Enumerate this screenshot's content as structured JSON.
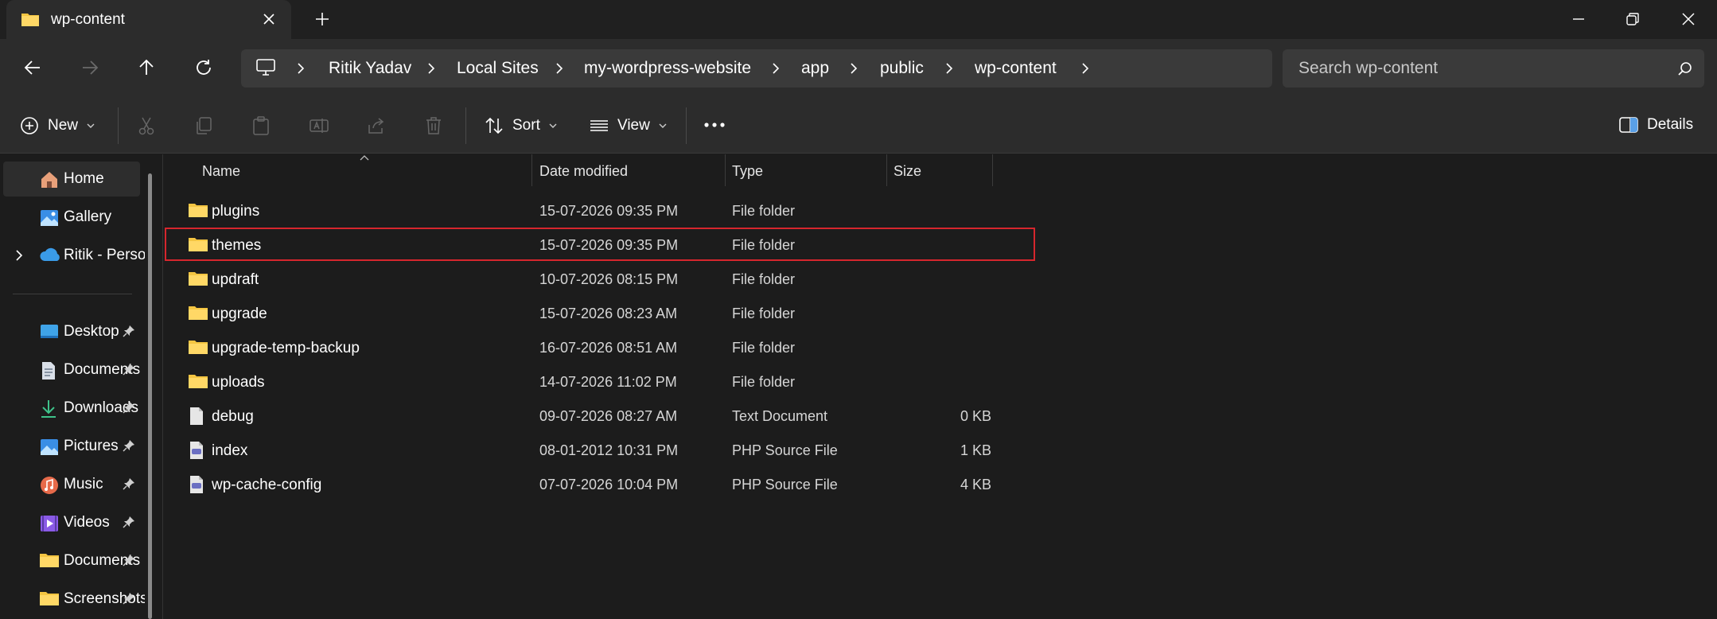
{
  "window": {
    "tab_title": "wp-content",
    "tab_icon": "folder-icon",
    "colors": {
      "background": "#1c1c1c",
      "chrome": "#2c2c2c",
      "folder": "#f4c542",
      "highlight": "#d6262d"
    }
  },
  "nav": {
    "back": "back-arrow-icon",
    "forward": "forward-arrow-icon",
    "up": "up-arrow-icon",
    "refresh": "refresh-icon"
  },
  "breadcrumb": [
    "Ritik Yadav",
    "Local Sites",
    "my-wordpress-website",
    "app",
    "public",
    "wp-content"
  ],
  "search": {
    "placeholder": "Search wp-content"
  },
  "toolbar": {
    "new_label": "New",
    "sort_label": "Sort",
    "view_label": "View",
    "details_label": "Details"
  },
  "sidebar": {
    "items": [
      {
        "label": "Home",
        "icon": "home-icon"
      },
      {
        "label": "Gallery",
        "icon": "gallery-icon"
      },
      {
        "label": "Ritik - Personal",
        "icon": "onedrive-cloud-icon"
      },
      {
        "label": "Desktop",
        "icon": "desktop-icon"
      },
      {
        "label": "Documents",
        "icon": "documents-icon"
      },
      {
        "label": "Downloads",
        "icon": "download-icon"
      },
      {
        "label": "Pictures",
        "icon": "pictures-icon"
      },
      {
        "label": "Music",
        "icon": "music-icon"
      },
      {
        "label": "Videos",
        "icon": "videos-icon"
      },
      {
        "label": "Documents",
        "icon": "folder-icon"
      },
      {
        "label": "Screenshots",
        "icon": "folder-icon"
      }
    ]
  },
  "columns": {
    "name": "Name",
    "date": "Date modified",
    "type": "Type",
    "size": "Size"
  },
  "files": [
    {
      "name": "plugins",
      "date": "15-07-2026 09:35 PM",
      "type": "File folder",
      "size": "",
      "icon": "folder-icon"
    },
    {
      "name": "themes",
      "date": "15-07-2026 09:35 PM",
      "type": "File folder",
      "size": "",
      "icon": "folder-icon"
    },
    {
      "name": "updraft",
      "date": "10-07-2026 08:15 PM",
      "type": "File folder",
      "size": "",
      "icon": "folder-icon"
    },
    {
      "name": "upgrade",
      "date": "15-07-2026 08:23 AM",
      "type": "File folder",
      "size": "",
      "icon": "folder-icon"
    },
    {
      "name": "upgrade-temp-backup",
      "date": "16-07-2026 08:51 AM",
      "type": "File folder",
      "size": "",
      "icon": "folder-icon"
    },
    {
      "name": "uploads",
      "date": "14-07-2026 11:02 PM",
      "type": "File folder",
      "size": "",
      "icon": "folder-icon"
    },
    {
      "name": "debug",
      "date": "09-07-2026 08:27 AM",
      "type": "Text Document",
      "size": "0 KB",
      "icon": "text-file-icon"
    },
    {
      "name": "index",
      "date": "08-01-2012 10:31 PM",
      "type": "PHP Source File",
      "size": "1 KB",
      "icon": "php-file-icon"
    },
    {
      "name": "wp-cache-config",
      "date": "07-07-2026 10:04 PM",
      "type": "PHP Source File",
      "size": "4 KB",
      "icon": "php-file-icon"
    }
  ]
}
